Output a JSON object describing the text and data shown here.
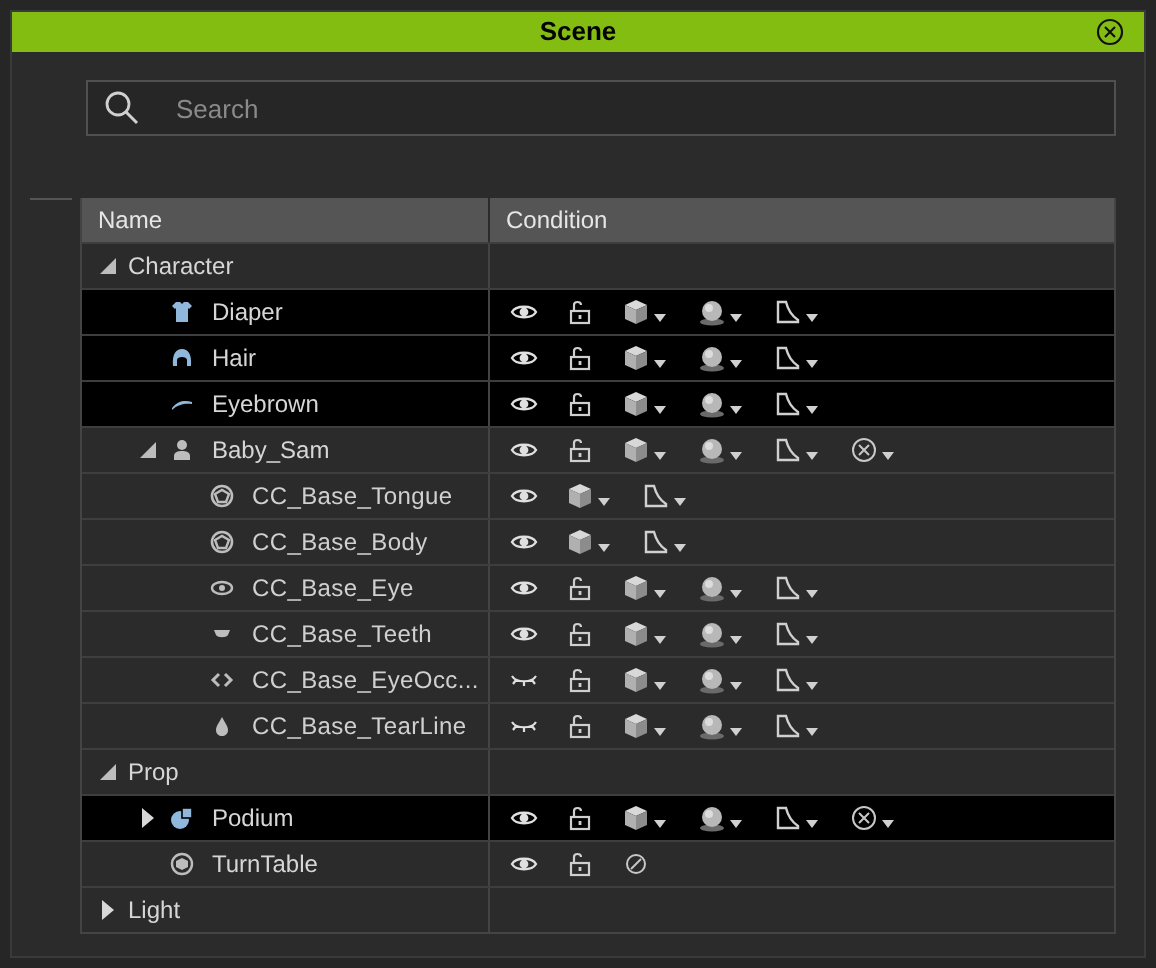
{
  "window": {
    "title": "Scene"
  },
  "search": {
    "placeholder": "Search"
  },
  "table": {
    "columns": [
      "Name",
      "Condition"
    ],
    "rows": [
      {
        "name": "Character",
        "kind": "category",
        "expanded": true,
        "selected": false,
        "children": [
          {
            "name": "Diaper",
            "kind": "cloth",
            "selected": true,
            "condition": [
              {
                "kind": "eye"
              },
              {
                "kind": "lock"
              },
              {
                "kind": "cube",
                "menu": true
              },
              {
                "kind": "sphere",
                "menu": true
              },
              {
                "kind": "corner",
                "menu": true
              }
            ]
          },
          {
            "name": "Hair",
            "kind": "hair",
            "selected": true,
            "condition": [
              {
                "kind": "eye"
              },
              {
                "kind": "lock"
              },
              {
                "kind": "cube",
                "menu": true
              },
              {
                "kind": "sphere",
                "menu": true
              },
              {
                "kind": "corner",
                "menu": true
              }
            ]
          },
          {
            "name": "Eyebrown",
            "kind": "brow",
            "selected": true,
            "condition": [
              {
                "kind": "eye"
              },
              {
                "kind": "lock"
              },
              {
                "kind": "cube",
                "menu": true
              },
              {
                "kind": "sphere",
                "menu": true
              },
              {
                "kind": "corner",
                "menu": true
              }
            ]
          },
          {
            "name": "Baby_Sam",
            "kind": "avatar",
            "expanded": true,
            "selected": false,
            "condition": [
              {
                "kind": "eye"
              },
              {
                "kind": "lock"
              },
              {
                "kind": "cube",
                "menu": true
              },
              {
                "kind": "sphere",
                "menu": true
              },
              {
                "kind": "corner",
                "menu": true
              },
              {
                "kind": "cancel",
                "menu": true
              }
            ],
            "children": [
              {
                "name": "CC_Base_Tongue",
                "kind": "mesh",
                "selected": false,
                "condition": [
                  {
                    "kind": "eye"
                  },
                  {
                    "kind": "cube",
                    "menu": true
                  },
                  {
                    "kind": "corner",
                    "menu": true
                  }
                ]
              },
              {
                "name": "CC_Base_Body",
                "kind": "mesh",
                "selected": false,
                "condition": [
                  {
                    "kind": "eye"
                  },
                  {
                    "kind": "cube",
                    "menu": true
                  },
                  {
                    "kind": "corner",
                    "menu": true
                  }
                ]
              },
              {
                "name": "CC_Base_Eye",
                "kind": "eyeball",
                "selected": false,
                "condition": [
                  {
                    "kind": "eye"
                  },
                  {
                    "kind": "lock"
                  },
                  {
                    "kind": "cube",
                    "menu": true
                  },
                  {
                    "kind": "sphere",
                    "menu": true
                  },
                  {
                    "kind": "corner",
                    "menu": true
                  }
                ]
              },
              {
                "name": "CC_Base_Teeth",
                "kind": "teeth",
                "selected": false,
                "condition": [
                  {
                    "kind": "eye"
                  },
                  {
                    "kind": "lock"
                  },
                  {
                    "kind": "cube",
                    "menu": true
                  },
                  {
                    "kind": "sphere",
                    "menu": true
                  },
                  {
                    "kind": "corner",
                    "menu": true
                  }
                ]
              },
              {
                "name": "CC_Base_EyeOcc...",
                "kind": "occlusion",
                "selected": false,
                "condition": [
                  {
                    "kind": "eye-closed"
                  },
                  {
                    "kind": "lock"
                  },
                  {
                    "kind": "cube",
                    "menu": true
                  },
                  {
                    "kind": "sphere",
                    "menu": true
                  },
                  {
                    "kind": "corner",
                    "menu": true
                  }
                ]
              },
              {
                "name": "CC_Base_TearLine",
                "kind": "tearline",
                "selected": false,
                "condition": [
                  {
                    "kind": "eye-closed"
                  },
                  {
                    "kind": "lock"
                  },
                  {
                    "kind": "cube",
                    "menu": true
                  },
                  {
                    "kind": "sphere",
                    "menu": true
                  },
                  {
                    "kind": "corner",
                    "menu": true
                  }
                ]
              }
            ]
          }
        ]
      },
      {
        "name": "Prop",
        "kind": "category",
        "expanded": true,
        "selected": false,
        "children": [
          {
            "name": "Podium",
            "kind": "prop",
            "expanded": false,
            "selected": true,
            "condition": [
              {
                "kind": "eye"
              },
              {
                "kind": "lock"
              },
              {
                "kind": "cube",
                "menu": true
              },
              {
                "kind": "sphere",
                "menu": true
              },
              {
                "kind": "corner",
                "menu": true
              },
              {
                "kind": "cancel",
                "menu": true
              }
            ]
          },
          {
            "name": "TurnTable",
            "kind": "turntable",
            "selected": false,
            "condition": [
              {
                "kind": "eye"
              },
              {
                "kind": "lock"
              },
              {
                "kind": "none"
              }
            ]
          }
        ]
      },
      {
        "name": "Light",
        "kind": "category",
        "expanded": false,
        "selected": false
      }
    ]
  }
}
